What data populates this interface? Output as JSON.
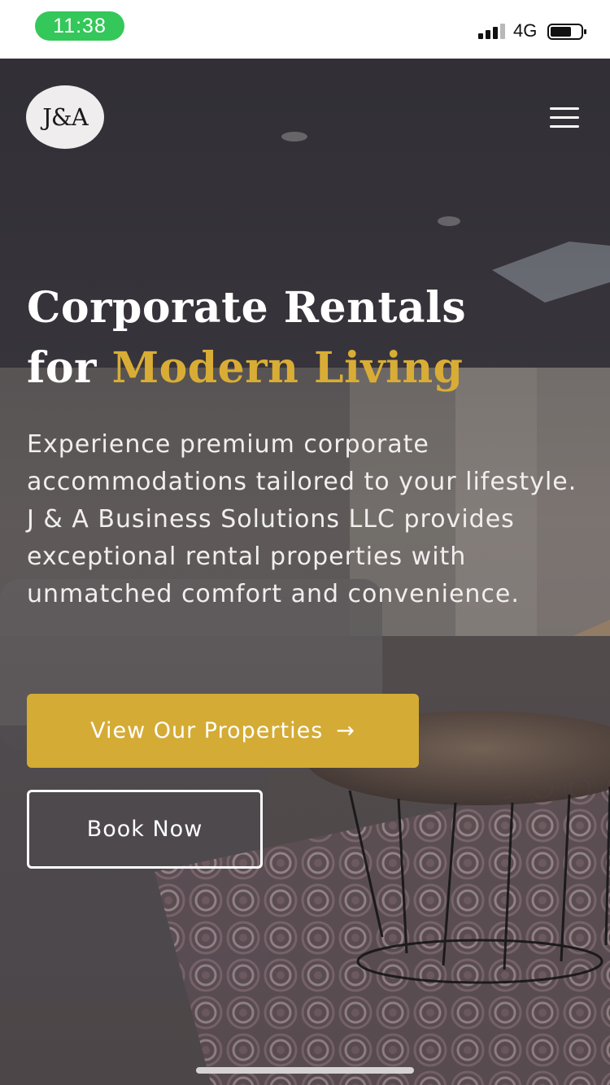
{
  "status_bar": {
    "time": "11:38",
    "network": "4G",
    "time_pill_color": "#34c759",
    "icons": [
      "signal-bars-icon",
      "battery-icon"
    ]
  },
  "header": {
    "logo_text": "J&A",
    "menu_icon": "hamburger-menu-icon"
  },
  "hero": {
    "headline_line1": "Corporate Rentals",
    "headline_line2_prefix": "for ",
    "headline_line2_accent": "Modern Living",
    "intro": "Experience premium corporate accommodations tailored to your lifestyle. J & A Business Solutions LLC provides exceptional rental properties with unmatched comfort and convenience.",
    "primary_cta": "View Our Properties",
    "primary_cta_icon": "arrow-right-icon",
    "secondary_cta": "Book Now"
  },
  "colors": {
    "accent": "#d4ab35",
    "headline_accent": "#d9ad35",
    "text": "#ffffff"
  }
}
